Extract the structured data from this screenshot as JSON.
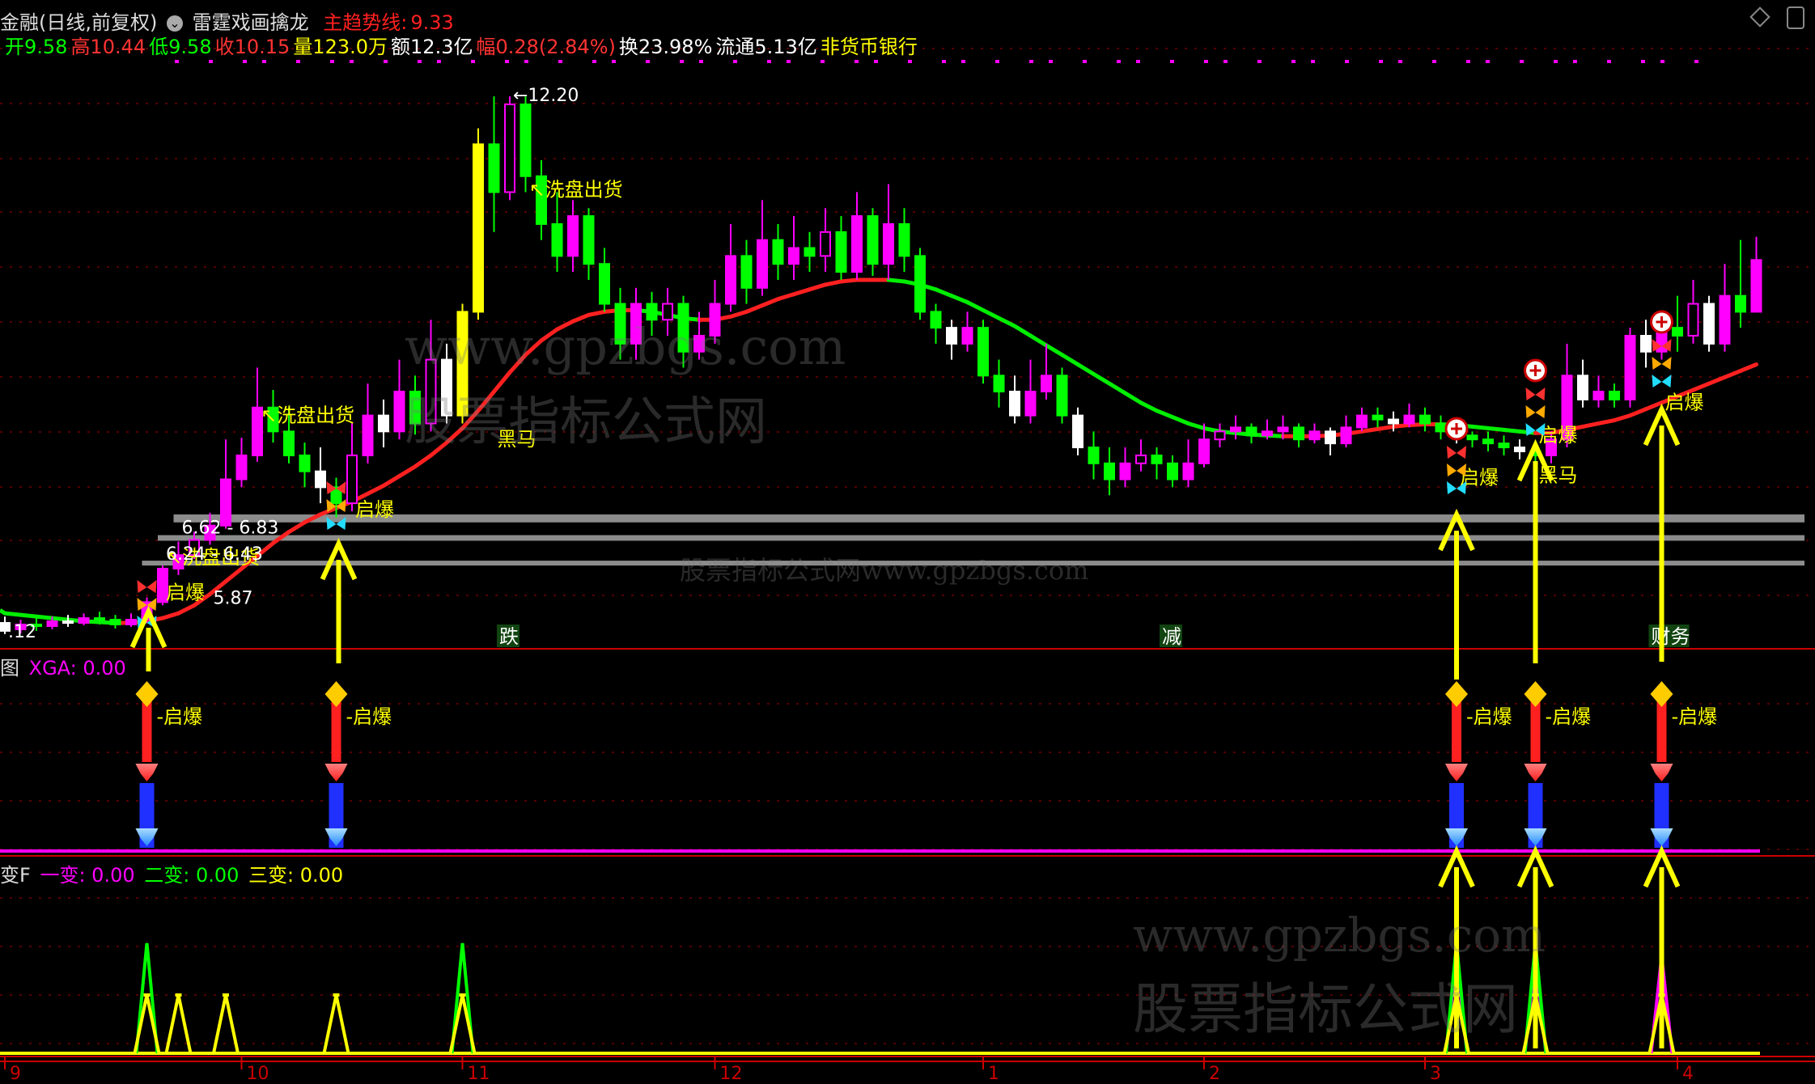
{
  "header": {
    "line1": {
      "name": "金融(日线,前复权)",
      "indicator": "雷霆戏画擒龙",
      "trend_label": "主趋势线:",
      "trend_value": "9.33"
    },
    "line2": [
      {
        "label": "开",
        "value": "9.58",
        "color": "#00ff00"
      },
      {
        "label": "高",
        "value": "10.44",
        "color": "#ff3333"
      },
      {
        "label": "低",
        "value": "9.58",
        "color": "#00ff00"
      },
      {
        "label": "收",
        "value": "10.15",
        "color": "#ff3333"
      },
      {
        "label": "量",
        "value": "123.0万",
        "color": "#ffff00"
      },
      {
        "label": "额",
        "value": "12.3亿",
        "color": "#ffffff"
      },
      {
        "label": "幅",
        "value": "0.28(2.84%)",
        "color": "#ff3333"
      },
      {
        "label": "换",
        "value": "23.98%",
        "color": "#ffffff"
      },
      {
        "label": "流通",
        "value": "5.13亿",
        "color": "#ffffff"
      },
      {
        "label": "",
        "value": "非货币银行",
        "color": "#ffff00"
      }
    ]
  },
  "panel2_header": {
    "prefix": "图",
    "series": "XGA: 0.00"
  },
  "panel3_header": {
    "prefix": "变F",
    "s1": "一变: 0.00",
    "s2": "二变: 0.00",
    "s3": "三变: 0.00"
  },
  "colors": {
    "up": "#ff00ff",
    "down": "#00ff00",
    "white": "#ffffff",
    "ma_up": "#ff2020",
    "ma_down": "#00ee00",
    "signal": "#ffff00",
    "band": "#8c8c8c"
  },
  "chart_data": [
    {
      "type": "candlestick",
      "title": "雷霆戏画擒龙",
      "ylim": [
        5.6,
        12.8
      ],
      "x_axis_labels": [
        {
          "label": "9",
          "index": 0
        },
        {
          "label": "10",
          "index": 15
        },
        {
          "label": "11",
          "index": 29
        },
        {
          "label": "12",
          "index": 45
        },
        {
          "label": "1",
          "index": 62
        },
        {
          "label": "2",
          "index": 76
        },
        {
          "label": "3",
          "index": 90
        },
        {
          "label": "4",
          "index": 106
        }
      ],
      "price_labels": [
        {
          "text": "12.20",
          "index": 32,
          "value": 12.2
        },
        {
          "text": "6.62 - 6.83",
          "index": 11,
          "value": 6.78
        },
        {
          "text": "6.24 - 6.43",
          "index": 10,
          "value": 6.45
        },
        {
          "text": "5.87",
          "index": 13,
          "value": 5.9
        },
        {
          "text": ".12",
          "index": 0,
          "value": 5.48
        }
      ],
      "support_bands": [
        {
          "low": 6.86,
          "high": 6.96,
          "from_index": 11
        },
        {
          "low": 6.63,
          "high": 6.7,
          "from_index": 10
        },
        {
          "low": 6.32,
          "high": 6.38,
          "from_index": 9
        }
      ],
      "annotations": [
        {
          "text": "洗盘出货",
          "index": 10,
          "value": 6.34
        },
        {
          "text": "洗盘出货",
          "index": 16,
          "value": 8.12
        },
        {
          "text": "洗盘出货",
          "index": 33,
          "value": 10.95
        },
        {
          "text": "黑马",
          "index": 31,
          "value": 7.82
        },
        {
          "text": "黑马",
          "index": 97,
          "value": 7.37
        },
        {
          "text": "启爆",
          "index": 10,
          "value": 5.9
        },
        {
          "text": "启爆",
          "index": 22,
          "value": 6.94
        },
        {
          "text": "启爆",
          "index": 92,
          "value": 7.34
        },
        {
          "text": "启爆",
          "index": 97,
          "value": 7.87
        },
        {
          "text": "启爆",
          "index": 105,
          "value": 8.28
        },
        {
          "text": "跌",
          "index": 32,
          "value": 5.26
        },
        {
          "text": "减",
          "index": 74,
          "value": 5.26
        },
        {
          "text": "财务",
          "index": 105,
          "value": 5.26
        }
      ],
      "signals_up": [
        9,
        21,
        92,
        97,
        105
      ],
      "candles": [
        [
          5.6,
          5.5,
          5.68,
          5.46
        ],
        [
          5.52,
          5.58,
          5.64,
          5.47
        ],
        [
          5.58,
          5.56,
          5.66,
          5.5
        ],
        [
          5.56,
          5.62,
          5.68,
          5.52
        ],
        [
          5.62,
          5.6,
          5.7,
          5.55
        ],
        [
          5.6,
          5.66,
          5.72,
          5.57
        ],
        [
          5.66,
          5.64,
          5.74,
          5.58
        ],
        [
          5.64,
          5.58,
          5.7,
          5.53
        ],
        [
          5.58,
          5.64,
          5.72,
          5.55
        ],
        [
          5.64,
          5.86,
          5.92,
          5.6
        ],
        [
          5.86,
          6.28,
          6.32,
          5.82
        ],
        [
          6.28,
          6.45,
          6.62,
          6.2
        ],
        [
          6.45,
          6.64,
          6.74,
          6.4
        ],
        [
          6.64,
          6.82,
          6.98,
          6.58
        ],
        [
          6.82,
          7.4,
          7.9,
          6.78
        ],
        [
          7.4,
          7.7,
          7.92,
          7.3
        ],
        [
          7.7,
          8.3,
          8.8,
          7.62
        ],
        [
          8.3,
          8.0,
          8.52,
          7.86
        ],
        [
          8.0,
          7.7,
          8.3,
          7.6
        ],
        [
          7.7,
          7.5,
          7.86,
          7.3
        ],
        [
          7.5,
          7.3,
          7.8,
          7.1
        ],
        [
          7.3,
          7.1,
          7.42,
          6.92
        ],
        [
          7.1,
          7.7,
          8.1,
          7.0
        ],
        [
          7.7,
          8.2,
          8.6,
          7.6
        ],
        [
          8.2,
          8.0,
          8.4,
          7.8
        ],
        [
          8.0,
          8.5,
          8.9,
          7.9
        ],
        [
          8.5,
          8.1,
          8.7,
          7.96
        ],
        [
          8.1,
          8.9,
          9.4,
          8.0
        ],
        [
          8.9,
          8.2,
          9.1,
          8.1
        ],
        [
          8.2,
          9.5,
          9.6,
          8.1
        ],
        [
          9.5,
          11.6,
          11.8,
          9.4
        ],
        [
          11.6,
          11.0,
          12.2,
          10.5
        ],
        [
          11.0,
          12.1,
          12.2,
          10.9
        ],
        [
          12.1,
          11.2,
          12.2,
          11.0
        ],
        [
          11.2,
          10.6,
          11.4,
          10.4
        ],
        [
          10.6,
          10.2,
          11.0,
          10.0
        ],
        [
          10.2,
          10.7,
          10.9,
          10.0
        ],
        [
          10.7,
          10.1,
          10.8,
          9.9
        ],
        [
          10.1,
          9.6,
          10.3,
          9.5
        ],
        [
          9.6,
          9.1,
          9.8,
          8.9
        ],
        [
          9.1,
          9.6,
          9.8,
          8.9
        ],
        [
          9.6,
          9.4,
          9.75,
          9.2
        ],
        [
          9.4,
          9.6,
          9.8,
          9.2
        ],
        [
          9.6,
          9.0,
          9.7,
          8.8
        ],
        [
          9.0,
          9.2,
          9.5,
          8.9
        ],
        [
          9.2,
          9.6,
          9.9,
          9.1
        ],
        [
          9.6,
          10.2,
          10.6,
          9.5
        ],
        [
          10.2,
          9.8,
          10.4,
          9.6
        ],
        [
          9.8,
          10.4,
          10.9,
          9.7
        ],
        [
          10.4,
          10.1,
          10.6,
          9.9
        ],
        [
          10.1,
          10.3,
          10.7,
          9.9
        ],
        [
          10.3,
          10.2,
          10.5,
          10.0
        ],
        [
          10.2,
          10.5,
          10.8,
          10.0
        ],
        [
          10.5,
          10.0,
          10.7,
          9.9
        ],
        [
          10.0,
          10.7,
          11.0,
          9.9
        ],
        [
          10.7,
          10.1,
          10.8,
          9.95
        ],
        [
          10.1,
          10.6,
          11.1,
          9.9
        ],
        [
          10.6,
          10.2,
          10.8,
          10.0
        ],
        [
          10.2,
          9.5,
          10.3,
          9.4
        ],
        [
          9.5,
          9.3,
          9.6,
          9.1
        ],
        [
          9.3,
          9.1,
          9.4,
          8.9
        ],
        [
          9.1,
          9.3,
          9.5,
          9.0
        ],
        [
          9.3,
          8.7,
          9.4,
          8.6
        ],
        [
          8.7,
          8.5,
          8.9,
          8.3
        ],
        [
          8.5,
          8.2,
          8.7,
          8.1
        ],
        [
          8.2,
          8.5,
          8.9,
          8.1
        ],
        [
          8.5,
          8.7,
          9.1,
          8.4
        ],
        [
          8.7,
          8.2,
          8.8,
          8.1
        ],
        [
          8.2,
          7.8,
          8.3,
          7.7
        ],
        [
          7.8,
          7.6,
          8.0,
          7.4
        ],
        [
          7.6,
          7.4,
          7.8,
          7.2
        ],
        [
          7.4,
          7.6,
          7.8,
          7.3
        ],
        [
          7.6,
          7.7,
          7.9,
          7.5
        ],
        [
          7.7,
          7.6,
          7.8,
          7.4
        ],
        [
          7.6,
          7.4,
          7.7,
          7.3
        ],
        [
          7.4,
          7.6,
          7.9,
          7.3
        ],
        [
          7.6,
          7.9,
          8.1,
          7.55
        ],
        [
          7.9,
          8.0,
          8.1,
          7.8
        ],
        [
          8.0,
          8.05,
          8.2,
          7.9
        ],
        [
          8.05,
          7.95,
          8.1,
          7.85
        ],
        [
          7.95,
          8.0,
          8.15,
          7.9
        ],
        [
          8.0,
          8.05,
          8.2,
          7.9
        ],
        [
          8.05,
          7.9,
          8.1,
          7.8
        ],
        [
          7.9,
          8.0,
          8.1,
          7.85
        ],
        [
          8.0,
          7.85,
          8.05,
          7.7
        ],
        [
          7.85,
          8.05,
          8.2,
          7.8
        ],
        [
          8.05,
          8.2,
          8.3,
          8.0
        ],
        [
          8.2,
          8.15,
          8.3,
          8.05
        ],
        [
          8.15,
          8.1,
          8.25,
          8.0
        ],
        [
          8.1,
          8.2,
          8.35,
          8.05
        ],
        [
          8.2,
          8.1,
          8.3,
          8.0
        ],
        [
          8.1,
          8.0,
          8.2,
          7.9
        ],
        [
          8.0,
          7.95,
          8.1,
          7.85
        ],
        [
          7.95,
          7.9,
          8.0,
          7.8
        ],
        [
          7.9,
          7.85,
          8.0,
          7.75
        ],
        [
          7.85,
          7.8,
          7.95,
          7.7
        ],
        [
          7.8,
          7.75,
          7.9,
          7.65
        ],
        [
          7.75,
          7.7,
          7.85,
          7.6
        ],
        [
          7.7,
          7.9,
          8.0,
          7.6
        ],
        [
          7.9,
          8.7,
          9.1,
          7.8
        ],
        [
          8.7,
          8.4,
          8.9,
          8.3
        ],
        [
          8.4,
          8.5,
          8.7,
          8.3
        ],
        [
          8.5,
          8.4,
          8.6,
          8.3
        ],
        [
          8.4,
          9.2,
          9.3,
          8.3
        ],
        [
          9.2,
          9.0,
          9.4,
          8.8
        ],
        [
          9.0,
          9.3,
          9.5,
          8.9
        ],
        [
          9.3,
          9.2,
          9.7,
          9.0
        ],
        [
          9.2,
          9.6,
          9.9,
          9.1
        ],
        [
          9.6,
          9.1,
          9.7,
          9.0
        ],
        [
          9.1,
          9.7,
          10.1,
          9.0
        ],
        [
          9.7,
          9.5,
          10.4,
          9.3
        ],
        [
          9.5,
          10.15,
          10.44,
          9.58
        ]
      ],
      "ma": [
        5.72,
        5.7,
        5.68,
        5.66,
        5.64,
        5.62,
        5.61,
        5.6,
        5.6,
        5.62,
        5.66,
        5.72,
        5.82,
        5.96,
        6.12,
        6.28,
        6.44,
        6.6,
        6.74,
        6.86,
        6.96,
        7.04,
        7.12,
        7.22,
        7.32,
        7.44,
        7.56,
        7.7,
        7.86,
        8.04,
        8.26,
        8.5,
        8.74,
        8.96,
        9.14,
        9.28,
        9.38,
        9.46,
        9.5,
        9.52,
        9.52,
        9.5,
        9.46,
        9.42,
        9.4,
        9.4,
        9.44,
        9.5,
        9.58,
        9.66,
        9.72,
        9.78,
        9.84,
        9.88,
        9.9,
        9.9,
        9.9,
        9.88,
        9.84,
        9.78,
        9.7,
        9.62,
        9.52,
        9.42,
        9.32,
        9.2,
        9.08,
        8.96,
        8.84,
        8.72,
        8.6,
        8.48,
        8.36,
        8.26,
        8.18,
        8.1,
        8.04,
        8.0,
        7.98,
        7.96,
        7.95,
        7.94,
        7.94,
        7.94,
        7.95,
        7.97,
        8.0,
        8.03,
        8.06,
        8.08,
        8.09,
        8.09,
        8.08,
        8.06,
        8.04,
        8.02,
        8.0,
        7.98,
        7.98,
        8.02,
        8.06,
        8.1,
        8.14,
        8.2,
        8.28,
        8.36,
        8.44,
        8.52,
        8.6,
        8.68,
        8.76,
        8.84
      ]
    },
    {
      "type": "bar",
      "title": "XGA",
      "series": [
        {
          "name": "XGA",
          "values": [
            0.0
          ]
        }
      ],
      "signal_label": "启爆",
      "signal_indices": [
        9,
        21,
        92,
        97,
        105
      ]
    },
    {
      "type": "line",
      "title": "变F",
      "series": [
        {
          "name": "一变",
          "color": "#ff00ff",
          "peaks": [
            92,
            97,
            105
          ]
        },
        {
          "name": "二变",
          "color": "#00ff00",
          "peaks": [
            9,
            29,
            92,
            97
          ]
        },
        {
          "name": "三变",
          "color": "#ffff00",
          "peaks": [
            9,
            11,
            14,
            21,
            29,
            92,
            97,
            105
          ]
        }
      ]
    }
  ]
}
